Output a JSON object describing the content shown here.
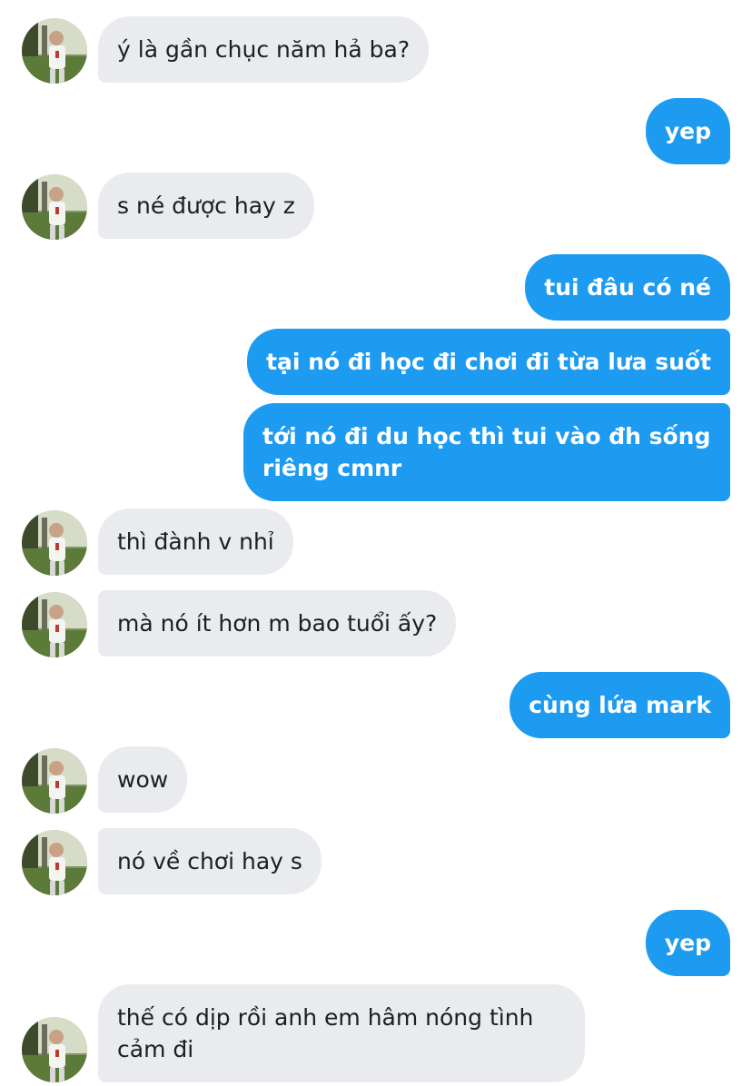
{
  "conversation": {
    "messages": [
      {
        "side": "in",
        "text": "ý là gần chục năm hả ba?"
      },
      {
        "side": "out",
        "text": "yep"
      },
      {
        "side": "in",
        "text": "s né được hay z"
      },
      {
        "side": "out",
        "text": "tui đâu có né"
      },
      {
        "side": "out",
        "text": "tại nó đi học đi chơi đi từa lưa suốt"
      },
      {
        "side": "out",
        "text": "tới nó đi du học thì tui vào đh sống riêng cmnr"
      },
      {
        "side": "in",
        "text": "thì đành v nhỉ"
      },
      {
        "side": "in",
        "text": "mà nó ít hơn m bao tuổi ấy?"
      },
      {
        "side": "out",
        "text": "cùng lứa mark"
      },
      {
        "side": "in",
        "text": "wow"
      },
      {
        "side": "in",
        "text": "nó về chơi hay s"
      },
      {
        "side": "out",
        "text": "yep"
      },
      {
        "side": "in",
        "text": "thế có dịp rồi anh em hâm nóng tình cảm đi"
      }
    ]
  },
  "colors": {
    "incoming_bubble": "#e9ebef",
    "incoming_text": "#1c1e21",
    "outgoing_bubble": "#1d9bf0",
    "outgoing_text": "#ffffff"
  },
  "icons": {
    "avatar": "user-avatar-photo"
  }
}
